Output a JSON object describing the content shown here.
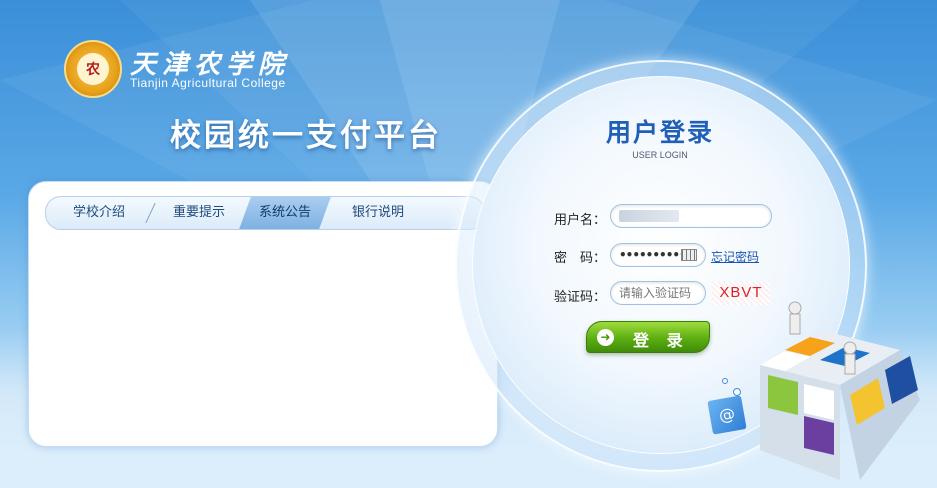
{
  "logo": {
    "seal_text": "农",
    "name_cn": "天津农学院",
    "name_en": "Tianjin Agricultural College"
  },
  "platform_title": "校园统一支付平台",
  "tabs": [
    {
      "label": "学校介绍",
      "active": false
    },
    {
      "label": "重要提示",
      "active": false
    },
    {
      "label": "系统公告",
      "active": true
    },
    {
      "label": "银行说明",
      "active": false
    }
  ],
  "login": {
    "title": "用户登录",
    "subtitle": "USER LOGIN",
    "username_label": "用户名：",
    "password_label": "密　码：",
    "password_value": "•••••••••••",
    "forgot_link": "忘记密码",
    "captcha_label": "验证码：",
    "captcha_placeholder": "请输入验证码",
    "captcha_code": "XBVT",
    "submit_label": "登 录"
  },
  "colors": {
    "accent": "#1f5fb8",
    "button_green": "#5cae13",
    "captcha_red": "#d8232a"
  },
  "icons": {
    "keyboard": "keyboard-icon",
    "login_button": "arrow-circle-icon",
    "mini_cube": "at-sign-icon"
  }
}
